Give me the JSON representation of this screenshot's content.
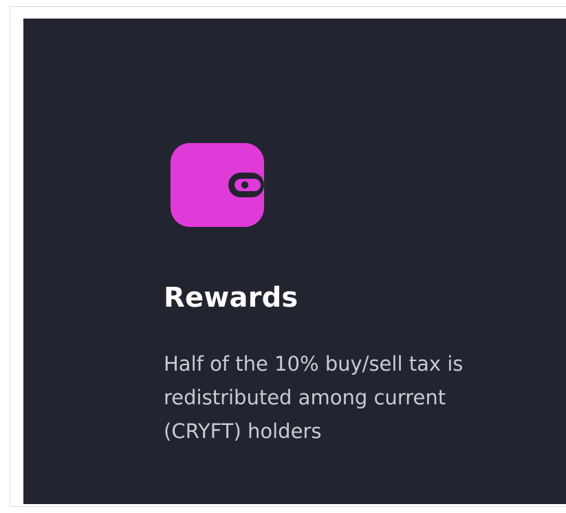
{
  "card": {
    "title": "Rewards",
    "description": "Half of the 10% buy/sell tax is redistributed among current (CRYFT) holders",
    "icon": "wallet-icon",
    "colors": {
      "background": "#222430",
      "icon": "#e03bd8",
      "title": "#ffffff",
      "description": "#c9cbd4"
    }
  }
}
